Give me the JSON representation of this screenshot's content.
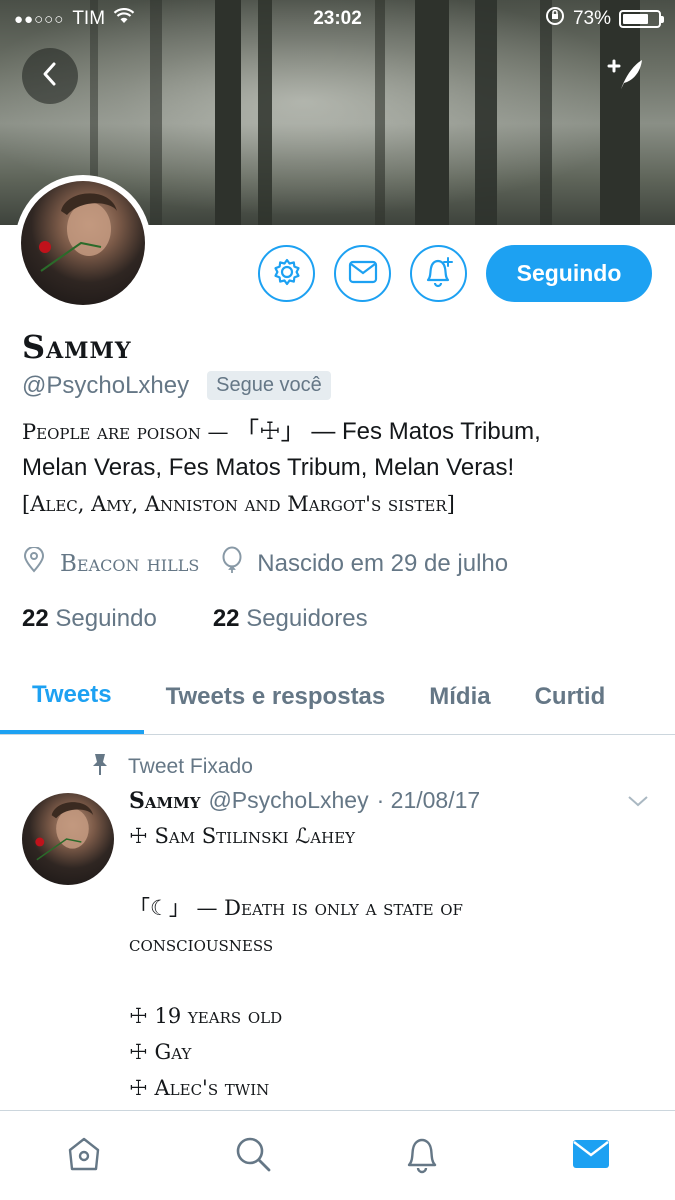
{
  "status_bar": {
    "carrier": "TIM",
    "time": "23:02",
    "battery": "73%",
    "battery_level": 0.73
  },
  "header": {
    "back_icon": "chevron-left-icon",
    "compose_icon": "compose-feather-icon"
  },
  "profile": {
    "display_name": "Sammy",
    "handle": "@PsychoLxhey",
    "follows_you": "Segue você",
    "bio_line1_a": "People are poison — ",
    "bio_line1_b": "「☩」 — Fes Matos Tribum,",
    "bio_line2": "Melan Veras, Fes Matos Tribum, Melan Veras!",
    "bio_line3": "[Alec, Amy, Anniston and Margot's sister]",
    "location": "Beacon hills",
    "birthday": "Nascido em 29 de julho",
    "following_count": "22",
    "following_label": "Seguindo",
    "followers_count": "22",
    "followers_label": "Seguidores"
  },
  "actions": {
    "settings_icon": "gear-icon",
    "message_icon": "envelope-icon",
    "notify_icon": "bell-plus-icon",
    "follow_label": "Seguindo"
  },
  "tabs": [
    {
      "label": "Tweets",
      "active": true
    },
    {
      "label": "Tweets e respostas",
      "active": false
    },
    {
      "label": "Mídia",
      "active": false
    },
    {
      "label": "Curtid",
      "active": false
    }
  ],
  "pinned_tweet": {
    "pinned_label": "Tweet Fixado",
    "name": "Sammy",
    "handle": "@PsychoLxhey",
    "date": "· 21/08/17",
    "text": "☩ Sam Stilinski ℒahey\n\n「☾」 — Death is only a state of\nconsciousness\n\n☩ 19 years old\n☩ Gay\n☩ Alec's twin"
  },
  "bottom_nav": [
    {
      "name": "home",
      "icon": "home-icon",
      "active": false
    },
    {
      "name": "search",
      "icon": "search-icon",
      "active": false
    },
    {
      "name": "notifications",
      "icon": "bell-icon",
      "active": false
    },
    {
      "name": "messages",
      "icon": "envelope-icon",
      "active": true
    }
  ],
  "colors": {
    "accent": "#1da1f2",
    "secondary_text": "#657786",
    "primary_text": "#14171a"
  }
}
